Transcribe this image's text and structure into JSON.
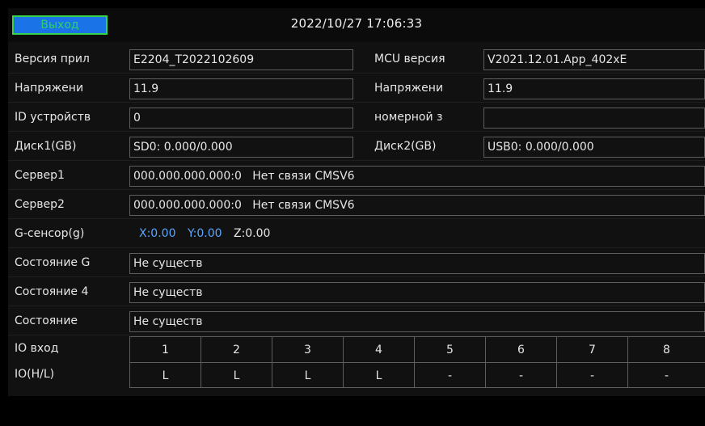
{
  "header": {
    "exit_label": "Выход",
    "datetime": "2022/10/27 17:06:33"
  },
  "rows": {
    "app_version": {
      "label": "Версия прил",
      "value": "E2204_T2022102609",
      "label2": "MCU версия",
      "value2": "V2021.12.01.App_402xE"
    },
    "voltage": {
      "label": "Напряжени",
      "value": "11.9",
      "label2": "Напряжени",
      "value2": "11.9"
    },
    "device_id": {
      "label": "ID устройств",
      "value": "0",
      "label2": "номерной з",
      "value2": ""
    },
    "disk": {
      "label": "Диск1(GB)",
      "value": "SD0: 0.000/0.000",
      "label2": "Диск2(GB)",
      "value2": "USB0: 0.000/0.000"
    },
    "server1": {
      "label": "Сервер1",
      "value": "000.000.000.000:0   Нет связи CMSV6"
    },
    "server2": {
      "label": "Сервер2",
      "value": "000.000.000.000:0   Нет связи CMSV6"
    },
    "gsensor": {
      "label": "G-сенсор(g)",
      "x": "X:0.00",
      "y": "Y:0.00",
      "z": "Z:0.00"
    },
    "state_g": {
      "label": "Состояние G",
      "value": "Не существ"
    },
    "state_4": {
      "label": "Состояние 4",
      "value": "Не существ"
    },
    "state": {
      "label": "Состояние",
      "value": "Не существ"
    }
  },
  "io": {
    "input_label": "IO вход",
    "level_label": "IO(H/L)",
    "channels": [
      "1",
      "2",
      "3",
      "4",
      "5",
      "6",
      "7",
      "8"
    ],
    "levels": [
      "L",
      "L",
      "L",
      "L",
      "-",
      "-",
      "-",
      "-"
    ]
  },
  "colors": {
    "exit_bg": "#1b73e8",
    "exit_text": "#2bd36a",
    "gsensor_axis": "#5aa6ff"
  }
}
